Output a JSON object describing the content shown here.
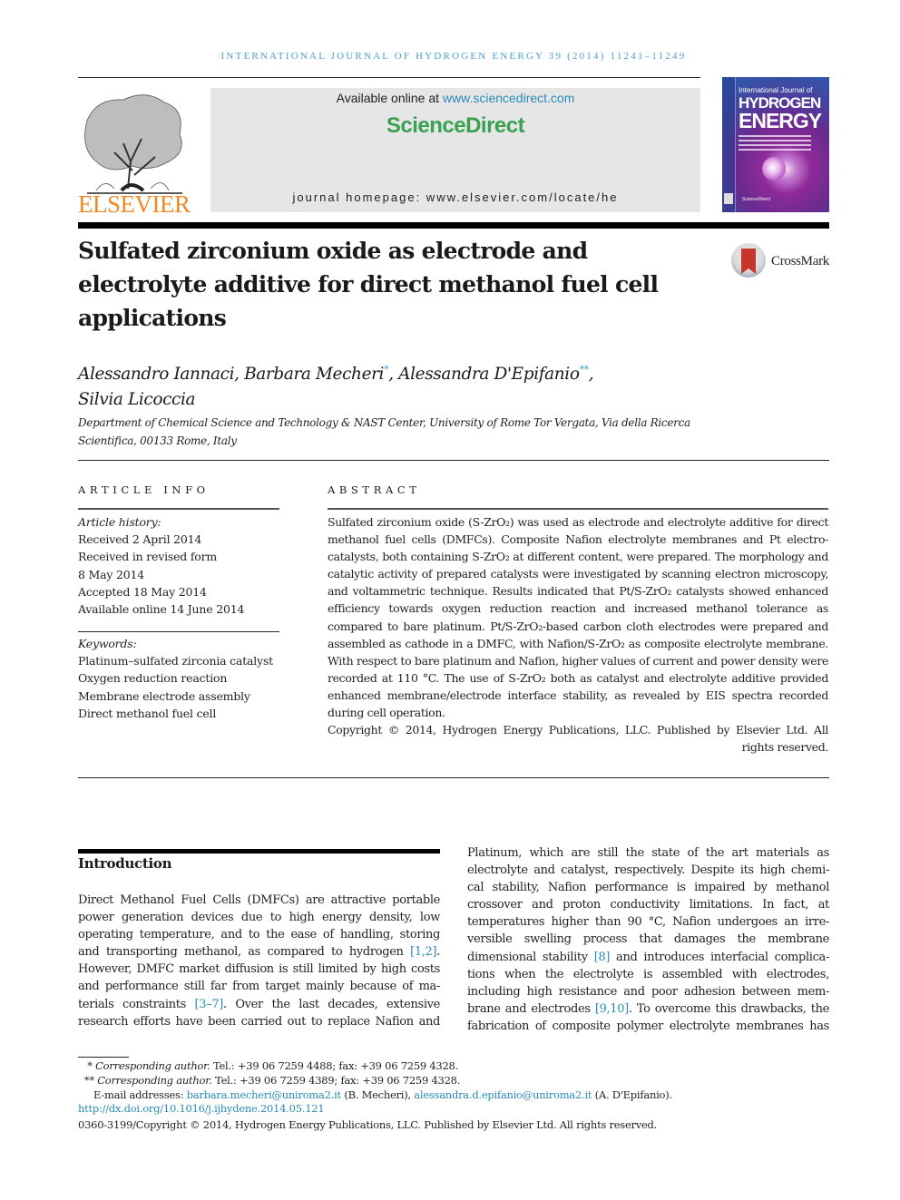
{
  "running_head": "International Journal of Hydrogen Energy 39 (2014) 11241–11249",
  "header": {
    "publisher_logo_text": "ELSEVIER",
    "available_online_prefix": "Available online at ",
    "available_online_link": "www.sciencedirect.com",
    "platform_name": "ScienceDirect",
    "journal_homepage": "journal homepage: www.elsevier.com/locate/he",
    "cover": {
      "line1": "International Journal of",
      "line2": "HYDROGEN",
      "line3": "ENERGY",
      "footer": "ScienceDirect"
    }
  },
  "crossmark_label": "CrossMark",
  "article": {
    "title": "Sulfated zirconium oxide as electrode and electrolyte additive for direct methanol fuel cell applications",
    "authors": [
      {
        "name": "Alessandro Iannaci",
        "mark": ""
      },
      {
        "name": "Barbara Mecheri",
        "mark": "*"
      },
      {
        "name": "Alessandra D'Epifanio",
        "mark": "**"
      },
      {
        "name": "Silvia Licoccia",
        "mark": ""
      }
    ],
    "affiliation_line1": "Department of Chemical Science and Technology & NAST Center, University of Rome Tor Vergata, Via della Ricerca",
    "affiliation_line2": "Scientifica, 00133 Rome, Italy"
  },
  "article_info": {
    "heading": "ARTICLE INFO",
    "history_label": "Article history:",
    "history": [
      "Received 2 April 2014",
      "Received in revised form",
      "8 May 2014",
      "Accepted 18 May 2014",
      "Available online 14 June 2014"
    ],
    "keywords_label": "Keywords:",
    "keywords": [
      "Platinum–sulfated zirconia catalyst",
      "Oxygen reduction reaction",
      "Membrane electrode assembly",
      "Direct methanol fuel cell"
    ]
  },
  "abstract": {
    "heading": "ABSTRACT",
    "text": "Sulfated zirconium oxide (S-ZrO₂) was used as electrode and electrolyte additive for direct methanol fuel cells (DMFCs). Composite Nafion electrolyte membranes and Pt electro-catalysts, both containing S-ZrO₂ at different content, were prepared. The morphology and catalytic activity of prepared catalysts were investigated by scanning electron microscopy, and voltammetric technique. Results indicated that Pt/S-ZrO₂ catalysts showed enhanced efficiency towards oxygen reduction reaction and increased methanol tolerance as compared to bare platinum. Pt/S-ZrO₂-based carbon cloth electrodes were prepared and assembled as cathode in a DMFC, with Nafion/S-ZrO₂ as composite electrolyte membrane. With respect to bare platinum and Nafion, higher values of current and power density were recorded at 110 °C. The use of S-ZrO₂ both as catalyst and electrolyte additive provided enhanced membrane/electrode interface stability, as revealed by EIS spectra recorded during cell operation.",
    "copyright": "Copyright © 2014, Hydrogen Energy Publications, LLC. Published by Elsevier Ltd. All rights reserved."
  },
  "introduction": {
    "heading": "Introduction",
    "left_lines": [
      "Direct Methanol Fuel Cells (DMFCs) are attractive portable",
      "power generation devices due to high energy density, low",
      "operating temperature, and to the ease of handling, storing",
      [
        "and transporting methanol, as compared to hydrogen ",
        "[1,2]",
        "."
      ],
      "However, DMFC market diffusion is still limited by high costs",
      "and performance still far from target mainly because of ma-",
      [
        "terials constraints ",
        "[3–7]",
        ". Over the last decades, extensive"
      ],
      "research efforts have been carried out to replace Nafion and"
    ],
    "right_lines": [
      "Platinum, which are still the state of the art materials as",
      "electrolyte and catalyst, respectively. Despite its high chemi-",
      "cal stability, Nafion performance is impaired by methanol",
      "crossover and proton conductivity limitations. In fact, at",
      "temperatures higher than 90 °C, Nafion undergoes an irre-",
      "versible swelling process that damages the membrane",
      [
        "dimensional stability ",
        "[8]",
        " and introduces interfacial complica-"
      ],
      "tions when the electrolyte is assembled with electrodes,",
      "including high resistance and poor adhesion between mem-",
      [
        "brane and electrodes ",
        "[9,10]",
        ". To overcome this drawbacks, the"
      ],
      "fabrication of composite polymer electrolyte membranes has"
    ],
    "references": [
      "[1,2]",
      "[3–7]",
      "[8]",
      "[9,10]"
    ]
  },
  "footnotes": {
    "fn1_mark": "*",
    "fn1_label": "Corresponding author.",
    "fn1_text": " Tel.: +39 06 7259 4488; fax: +39 06 7259 4328.",
    "fn2_mark": "**",
    "fn2_label": "Corresponding author.",
    "fn2_text": " Tel.: +39 06 7259 4389; fax: +39 06 7259 4328.",
    "email_prefix": "E-mail addresses: ",
    "email1": "barbara.mecheri@uniroma2.it",
    "email1_owner": " (B. Mecheri), ",
    "email2": "alessandra.d.epifanio@uniroma2.it",
    "email2_owner": " (A. D'Epifanio).",
    "doi": "http://dx.doi.org/10.1016/j.ijhydene.2014.05.121",
    "issn_copyright": "0360-3199/Copyright © 2014, Hydrogen Energy Publications, LLC. Published by Elsevier Ltd. All rights reserved."
  }
}
